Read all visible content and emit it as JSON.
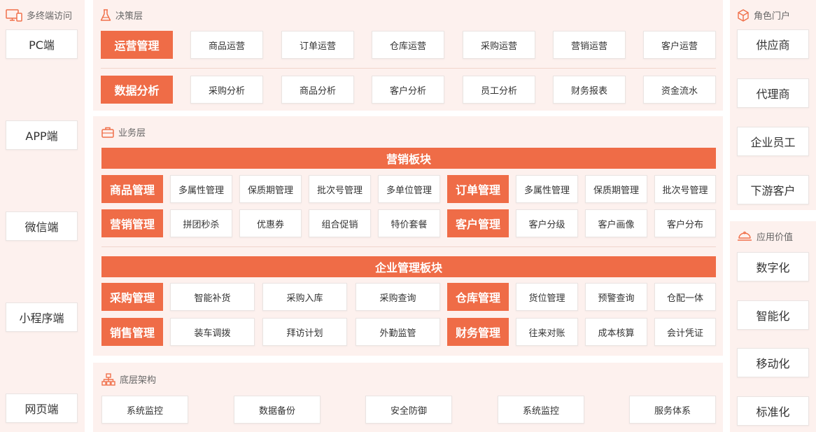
{
  "colors": {
    "accent": "#ef6c47",
    "panel": "#fdf1ee",
    "icon": "#f0714b"
  },
  "left": {
    "title": "多终端访问",
    "icon": "monitor-icon",
    "items": [
      "PC端",
      "APP端",
      "微信端",
      "小程序端",
      "网页端"
    ]
  },
  "decision": {
    "title": "决策层",
    "icon": "flask-icon",
    "rows": [
      {
        "head": "运营管理",
        "items": [
          "商品运营",
          "订单运营",
          "仓库运营",
          "采购运营",
          "营销运营",
          "客户运营"
        ]
      },
      {
        "head": "数据分析",
        "items": [
          "采购分析",
          "商品分析",
          "客户分析",
          "员工分析",
          "财务报表",
          "资金流水"
        ]
      }
    ]
  },
  "business": {
    "title": "业务层",
    "icon": "briefcase-icon",
    "marketing": {
      "title": "营销板块",
      "rows": [
        {
          "head1": "商品管理",
          "items1": [
            "多属性管理",
            "保质期管理",
            "批次号管理",
            "多单位管理"
          ],
          "head2": "订单管理",
          "items2": [
            "多属性管理",
            "保质期管理",
            "批次号管理"
          ]
        },
        {
          "head1": "营销管理",
          "items1": [
            "拼团秒杀",
            "优惠券",
            "组合促销",
            "特价套餐"
          ],
          "head2": "客户管理",
          "items2": [
            "客户分级",
            "客户画像",
            "客户分布"
          ]
        }
      ]
    },
    "enterprise": {
      "title": "企业管理板块",
      "rows": [
        {
          "head1": "采购管理",
          "items1": [
            "智能补货",
            "采购入库",
            "采购查询"
          ],
          "head2": "仓库管理",
          "items2": [
            "货位管理",
            "预警查询",
            "仓配一体"
          ]
        },
        {
          "head1": "销售管理",
          "items1": [
            "装车调拨",
            "拜访计划",
            "外勤监管"
          ],
          "head2": "财务管理",
          "items2": [
            "往来对账",
            "成本核算",
            "会计凭证"
          ]
        }
      ]
    }
  },
  "infra": {
    "title": "底层架构",
    "icon": "hierarchy-icon",
    "items": [
      "系统监控",
      "数据备份",
      "安全防御",
      "系统监控",
      "服务体系"
    ]
  },
  "roles": {
    "title": "角色门户",
    "icon": "cube-icon",
    "items": [
      "供应商",
      "代理商",
      "企业员工",
      "下游客户"
    ]
  },
  "value": {
    "title": "应用价值",
    "icon": "platter-icon",
    "items": [
      "数字化",
      "智能化",
      "移动化",
      "标准化"
    ]
  }
}
